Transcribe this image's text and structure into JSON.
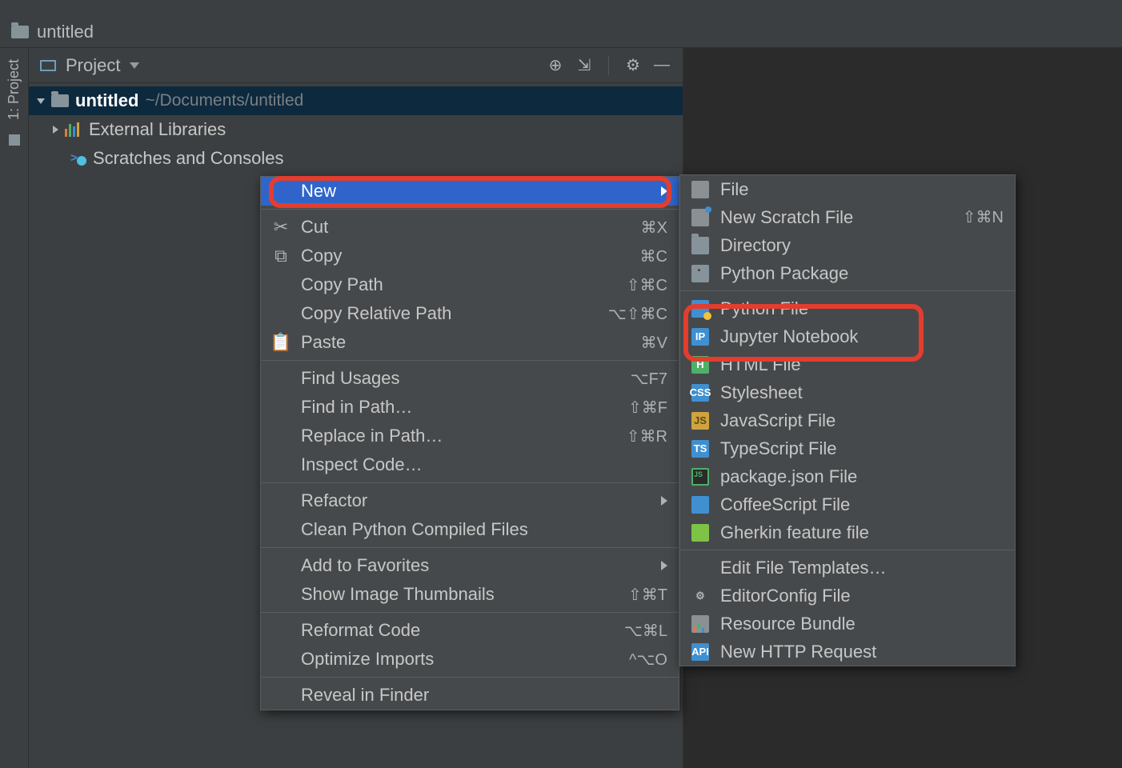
{
  "breadcrumb": {
    "project": "untitled"
  },
  "sidebar": {
    "label": "1: Project"
  },
  "panel": {
    "title": "Project"
  },
  "tree": {
    "root_name": "untitled",
    "root_path": "~/Documents/untitled",
    "ext_libs": "External Libraries",
    "scratch": "Scratches and Consoles"
  },
  "context_menu": [
    {
      "type": "item",
      "label": "New",
      "submenu": true,
      "highlight": true,
      "icon": ""
    },
    {
      "type": "sep"
    },
    {
      "type": "item",
      "label": "Cut",
      "shortcut": "⌘X",
      "icon": "✂"
    },
    {
      "type": "item",
      "label": "Copy",
      "shortcut": "⌘C",
      "icon": "⧉"
    },
    {
      "type": "item",
      "label": "Copy Path",
      "shortcut": "⇧⌘C",
      "icon": ""
    },
    {
      "type": "item",
      "label": "Copy Relative Path",
      "shortcut": "⌥⇧⌘C",
      "icon": ""
    },
    {
      "type": "item",
      "label": "Paste",
      "shortcut": "⌘V",
      "icon": "📋"
    },
    {
      "type": "sep"
    },
    {
      "type": "item",
      "label": "Find Usages",
      "shortcut": "⌥F7",
      "icon": ""
    },
    {
      "type": "item",
      "label": "Find in Path…",
      "shortcut": "⇧⌘F",
      "icon": ""
    },
    {
      "type": "item",
      "label": "Replace in Path…",
      "shortcut": "⇧⌘R",
      "icon": ""
    },
    {
      "type": "item",
      "label": "Inspect Code…",
      "icon": ""
    },
    {
      "type": "sep"
    },
    {
      "type": "item",
      "label": "Refactor",
      "submenu": true,
      "icon": ""
    },
    {
      "type": "item",
      "label": "Clean Python Compiled Files",
      "icon": ""
    },
    {
      "type": "sep"
    },
    {
      "type": "item",
      "label": "Add to Favorites",
      "submenu": true,
      "icon": ""
    },
    {
      "type": "item",
      "label": "Show Image Thumbnails",
      "shortcut": "⇧⌘T",
      "icon": ""
    },
    {
      "type": "sep"
    },
    {
      "type": "item",
      "label": "Reformat Code",
      "shortcut": "⌥⌘L",
      "icon": ""
    },
    {
      "type": "item",
      "label": "Optimize Imports",
      "shortcut": "^⌥O",
      "icon": ""
    },
    {
      "type": "sep"
    },
    {
      "type": "item",
      "label": "Reveal in Finder",
      "icon": ""
    }
  ],
  "submenu": [
    {
      "type": "item",
      "label": "File",
      "icon": "file"
    },
    {
      "type": "item",
      "label": "New Scratch File",
      "shortcut": "⇧⌘N",
      "icon": "scratch"
    },
    {
      "type": "item",
      "label": "Directory",
      "icon": "dir"
    },
    {
      "type": "item",
      "label": "Python Package",
      "icon": "pkg"
    },
    {
      "type": "sep"
    },
    {
      "type": "item",
      "label": "Python File",
      "icon": "py"
    },
    {
      "type": "item",
      "label": "Jupyter Notebook",
      "icon": "jup",
      "icon_text": "IP"
    },
    {
      "type": "item",
      "label": "HTML File",
      "icon": "html",
      "icon_text": "H"
    },
    {
      "type": "item",
      "label": "Stylesheet",
      "icon": "css",
      "icon_text": "CSS"
    },
    {
      "type": "item",
      "label": "JavaScript File",
      "icon": "js",
      "icon_text": "JS"
    },
    {
      "type": "item",
      "label": "TypeScript File",
      "icon": "ts",
      "icon_text": "TS"
    },
    {
      "type": "item",
      "label": "package.json File",
      "icon": "json"
    },
    {
      "type": "item",
      "label": "CoffeeScript File",
      "icon": "coffee"
    },
    {
      "type": "item",
      "label": "Gherkin feature file",
      "icon": "gherkin"
    },
    {
      "type": "sep"
    },
    {
      "type": "item",
      "label": "Edit File Templates…",
      "icon": ""
    },
    {
      "type": "item",
      "label": "EditorConfig File",
      "icon": "editorcfg",
      "icon_text": "⚙"
    },
    {
      "type": "item",
      "label": "Resource Bundle",
      "icon": "resource"
    },
    {
      "type": "item",
      "label": "New HTTP Request",
      "icon": "api",
      "icon_text": "API"
    }
  ]
}
